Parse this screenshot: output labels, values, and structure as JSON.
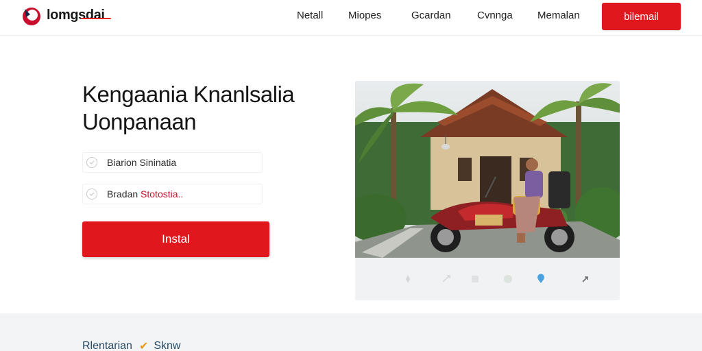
{
  "header": {
    "brand": "lomgsdai",
    "nav": [
      "Netall",
      "Miopes",
      "Gcardan",
      "Cvnnga",
      "Memalan"
    ],
    "cta_label": "bilemail"
  },
  "hero": {
    "title_line1": "Kengaania Knanlsalia",
    "title_line2": "Uonpanaan",
    "options": [
      {
        "label": "Biarion Sininatia"
      },
      {
        "label_prefix": "Bradan ",
        "label_accent": "Stotostia.."
      }
    ],
    "install_label": "Instal"
  },
  "footer": {
    "left_label": "Rlentarian",
    "right_label": "Sknw"
  },
  "colors": {
    "brand_red": "#e1171e",
    "accent_red": "#c8102e",
    "check_orange": "#e89a1c",
    "footer_text": "#284b66"
  },
  "icons": [
    "logo-mark-icon",
    "radio-icon",
    "photo-toolbar-icons",
    "check-icon"
  ]
}
